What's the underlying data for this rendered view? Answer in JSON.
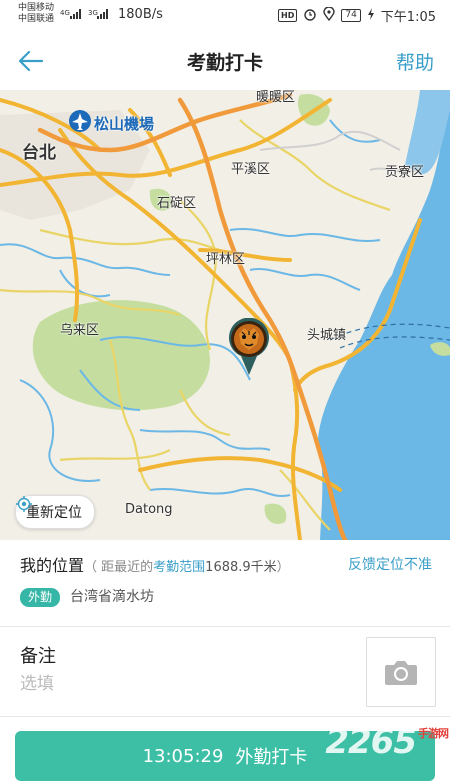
{
  "status_bar": {
    "carrier_1": "中国移动",
    "carrier_2": "中国联通",
    "network_1": "4G",
    "network_2": "3G",
    "speed": "180B/s",
    "hd": "HD",
    "battery": "74",
    "time": "下午1:05"
  },
  "header": {
    "title": "考勤打卡",
    "help": "帮助"
  },
  "map": {
    "labels": {
      "airport": "松山機場",
      "taipei": "台北",
      "xiangliao": "暖暖区",
      "pingxi": "平溪区",
      "gongliao": "贡寮区",
      "shiding": "石碇区",
      "pinglin": "坪林区",
      "wulai": "乌来区",
      "toucheng": "头城镇",
      "datong": "Datong"
    },
    "relocate_label": "重新定位"
  },
  "location": {
    "label": "我的位置",
    "note_prefix": "（ 距最近的",
    "note_range": "考勤范围",
    "note_distance": "1688.9千米",
    "note_suffix": "）",
    "feedback": "反馈定位不准",
    "tag": "外勤",
    "address": "台湾省滴水坊"
  },
  "remark": {
    "label": "备注",
    "placeholder": "选填"
  },
  "punch": {
    "time": "13:05:29",
    "label": "外勤打卡"
  },
  "watermark": {
    "number": "2265",
    "sub": "手游网"
  },
  "colors": {
    "accent": "#3a9fc8",
    "button": "#3dbfa6",
    "tag": "#36b6a6",
    "map_bg": "#f2efe6",
    "water": "#6bb7e6",
    "park": "#c5dea0",
    "road_major": "#f2b533",
    "road_minor": "#e9d466"
  }
}
